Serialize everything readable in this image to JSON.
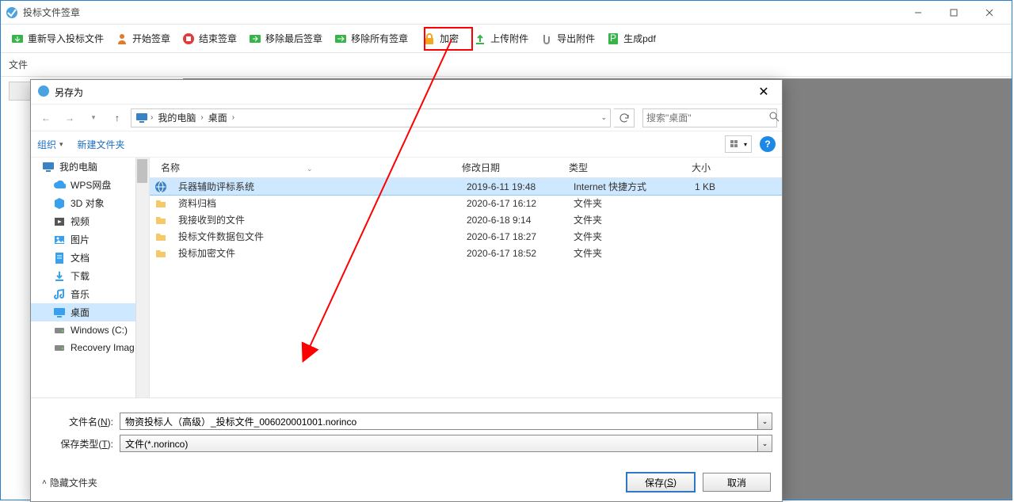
{
  "app": {
    "title": "投标文件签章",
    "file_label": "文件"
  },
  "toolbar": {
    "reimport": "重新导入投标文件",
    "start_sign": "开始签章",
    "end_sign": "结束签章",
    "remove_last": "移除最后签章",
    "remove_all": "移除所有签章",
    "encrypt": "加密",
    "upload": "上传附件",
    "export": "导出附件",
    "gen_pdf": "生成pdf"
  },
  "saveas": {
    "title": "另存为",
    "breadcrumb": {
      "seg1": "我的电脑",
      "seg2": "桌面"
    },
    "search_placeholder": "搜索\"桌面\"",
    "organize": "组织",
    "new_folder": "新建文件夹",
    "headers": {
      "name": "名称",
      "date": "修改日期",
      "type": "类型",
      "size": "大小"
    },
    "tree": [
      {
        "label": "我的电脑",
        "icon": "monitor",
        "indent": 0
      },
      {
        "label": "WPS网盘",
        "icon": "cloud",
        "indent": 1
      },
      {
        "label": "3D 对象",
        "icon": "cube",
        "indent": 1
      },
      {
        "label": "视频",
        "icon": "video",
        "indent": 1
      },
      {
        "label": "图片",
        "icon": "image",
        "indent": 1
      },
      {
        "label": "文档",
        "icon": "doc",
        "indent": 1
      },
      {
        "label": "下载",
        "icon": "download",
        "indent": 1
      },
      {
        "label": "音乐",
        "icon": "music",
        "indent": 1
      },
      {
        "label": "桌面",
        "icon": "desktop",
        "indent": 1,
        "selected": true
      },
      {
        "label": "Windows (C:)",
        "icon": "drive",
        "indent": 1
      },
      {
        "label": "Recovery Imag",
        "icon": "drive",
        "indent": 1
      }
    ],
    "files": [
      {
        "name": "兵器辅助评标系统",
        "date": "2019-6-11 19:48",
        "type": "Internet 快捷方式",
        "size": "1 KB",
        "icon": "globe",
        "selected": true
      },
      {
        "name": "资料归档",
        "date": "2020-6-17 16:12",
        "type": "文件夹",
        "size": "",
        "icon": "folder"
      },
      {
        "name": "我接收到的文件",
        "date": "2020-6-18 9:14",
        "type": "文件夹",
        "size": "",
        "icon": "folder"
      },
      {
        "name": "投标文件数据包文件",
        "date": "2020-6-17 18:27",
        "type": "文件夹",
        "size": "",
        "icon": "folder"
      },
      {
        "name": "投标加密文件",
        "date": "2020-6-17 18:52",
        "type": "文件夹",
        "size": "",
        "icon": "folder"
      }
    ],
    "filename_label_pre": "文件名(",
    "filename_label_u": "N",
    "filename_label_post": "):",
    "filename_value": "物资投标人（高级）_投标文件_006020001001.norinco",
    "filetype_label_pre": "保存类型(",
    "filetype_label_u": "T",
    "filetype_label_post": "):",
    "filetype_value": "文件(*.norinco)",
    "hide_folders": "隐藏文件夹",
    "save_btn_pre": "保存(",
    "save_btn_u": "S",
    "save_btn_post": ")",
    "cancel_btn": "取消"
  }
}
